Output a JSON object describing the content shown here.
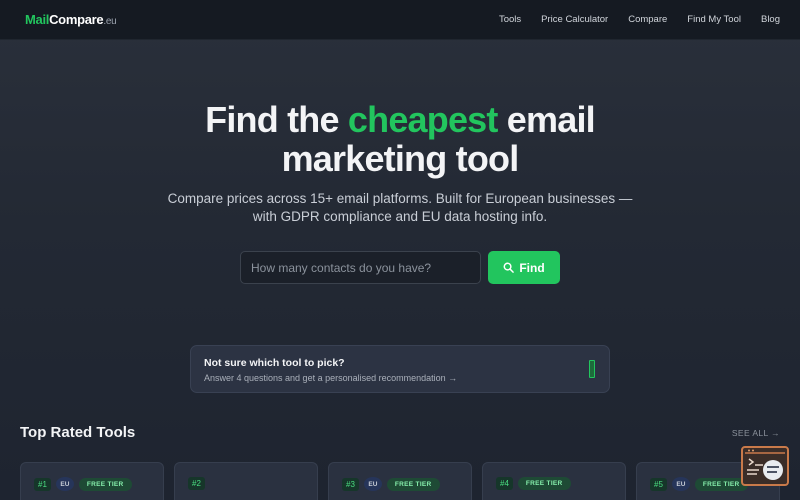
{
  "brand": {
    "mail": "Mail",
    "compare": "Compare",
    "tld": ".eu"
  },
  "nav": {
    "links": [
      "Tools",
      "Price Calculator",
      "Compare",
      "Find My Tool",
      "Blog"
    ]
  },
  "hero": {
    "title_part1": "Find the ",
    "title_accent": "cheapest",
    "title_part2": " email",
    "title_line2": "marketing tool",
    "subtitle_line1": "Compare prices across 15+ email platforms. Built for European businesses —",
    "subtitle_line2": "with GDPR compliance and EU data hosting info."
  },
  "search": {
    "placeholder": "How many contacts do you have?",
    "value": "",
    "button_label": "Find"
  },
  "recommend": {
    "title": "Not sure which tool to pick?",
    "text": "Answer 4 questions and get a personalised recommendation →"
  },
  "top_rated": {
    "title": "Top Rated Tools",
    "see_all": "SEE ALL →",
    "cards": [
      {
        "rank": "#1",
        "eu": "EU",
        "free": "FREE TIER"
      },
      {
        "rank": "#2",
        "eu": "",
        "free": ""
      },
      {
        "rank": "#3",
        "eu": "EU",
        "free": "FREE TIER"
      },
      {
        "rank": "#4",
        "eu": "",
        "free": "FREE TIER"
      },
      {
        "rank": "#5",
        "eu": "EU",
        "free": "FREE TIER"
      }
    ]
  },
  "colors": {
    "accent": "#22c55e",
    "nav_bg": "#151a22",
    "page_bg": "#232934",
    "card_bg": "#2a3140"
  },
  "icons": {
    "find": "search-icon",
    "recommend": "progress-bar-icon",
    "widget": "terminal-chat-icon"
  }
}
